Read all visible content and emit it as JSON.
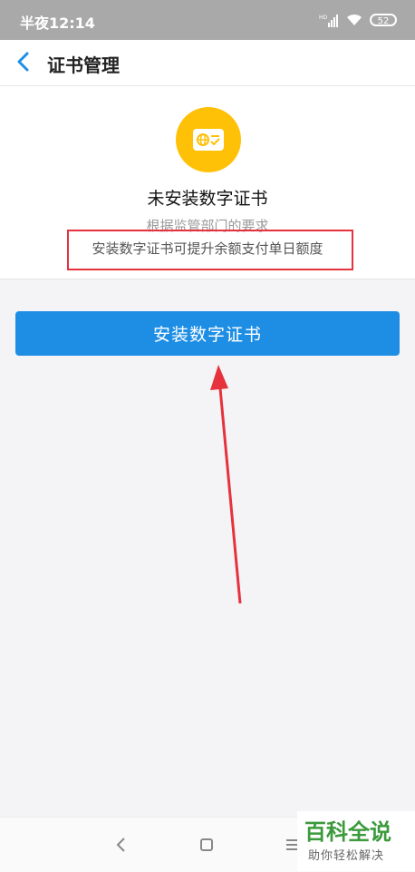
{
  "status_bar": {
    "time": "半夜12:14",
    "signal_label": "HD",
    "battery": "52"
  },
  "header": {
    "title": "证书管理"
  },
  "certificate": {
    "status": "未安装数字证书",
    "note_line1": "根据监管部门的要求",
    "note_line2": "安装数字证书可提升余额支付单日额度"
  },
  "actions": {
    "install_label": "安装数字证书"
  },
  "watermark": {
    "main": "百科全说",
    "sub": "助你轻松解决"
  },
  "colors": {
    "accent": "#1e8ee5",
    "icon_bg": "#ffc107",
    "highlight": "#e5323d",
    "watermark": "#3c9a3c"
  }
}
